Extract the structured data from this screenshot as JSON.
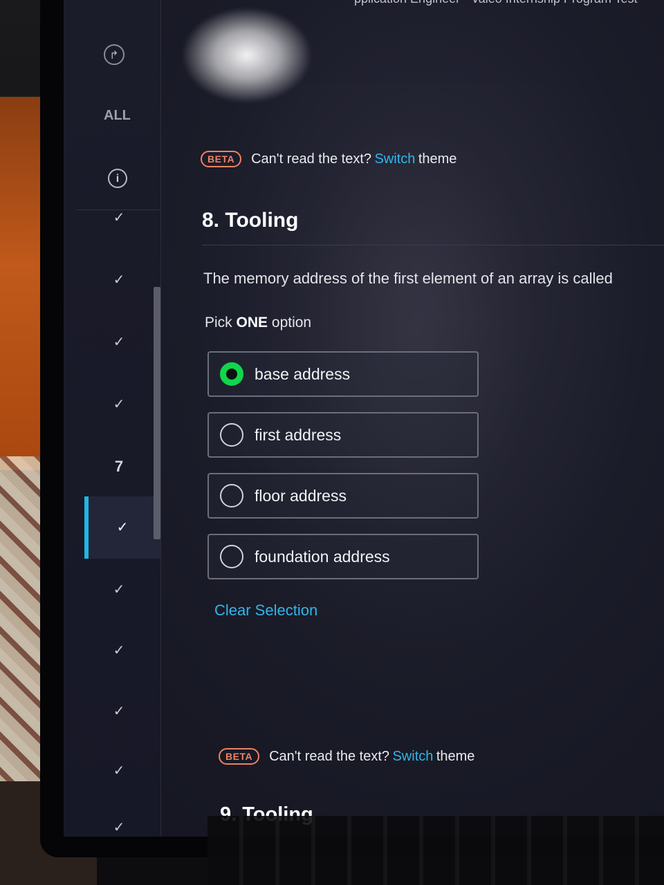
{
  "header": {
    "test_title": "pplication Engineer - Valeo Internship Program Test"
  },
  "sidebar": {
    "share_icon": "share-icon",
    "filter_label": "ALL",
    "info_icon": "info-icon",
    "items": [
      {
        "label": "✓"
      },
      {
        "label": "✓"
      },
      {
        "label": "✓"
      },
      {
        "label": "✓"
      },
      {
        "label": "7"
      },
      {
        "label": "✓"
      },
      {
        "label": "✓"
      },
      {
        "label": "✓"
      },
      {
        "label": "✓"
      },
      {
        "label": "✓"
      },
      {
        "label": "✓"
      }
    ],
    "accent_color": "#1fb6e5"
  },
  "beta": {
    "badge": "BETA",
    "text": "Can't read the text?",
    "link": "Switch",
    "suffix": "theme"
  },
  "question": {
    "title": "8. Tooling",
    "prompt": "The memory address of the first element of an array is called",
    "pick_prefix": "Pick",
    "pick_emphasis": "ONE",
    "pick_suffix": "option",
    "options": [
      {
        "label": "base address",
        "selected": true
      },
      {
        "label": "first address",
        "selected": false
      },
      {
        "label": "floor address",
        "selected": false
      },
      {
        "label": "foundation address",
        "selected": false
      }
    ],
    "clear_label": "Clear Selection",
    "selected_color": "#11d64b"
  },
  "next_question": {
    "title": "9. Tooling"
  }
}
